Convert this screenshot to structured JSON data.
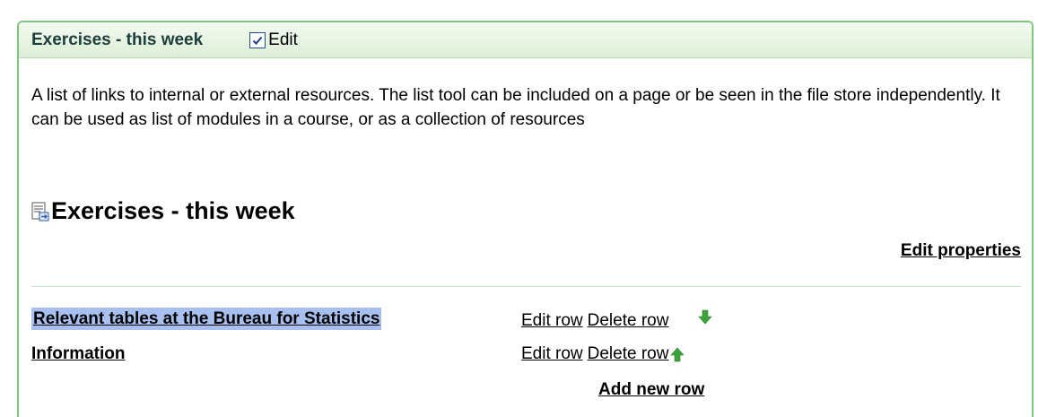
{
  "panel": {
    "title": "Exercises - this week",
    "edit_label": "Edit",
    "edit_checked": true
  },
  "description": "A list of links to internal or external resources. The list tool can be included on a page or be seen in the file store independently. It can be used as list of modules in a course, or as a collection of resources",
  "list": {
    "heading": "Exercises - this week",
    "edit_properties": "Edit properties",
    "rows": [
      {
        "title": "Relevant tables at the Bureau for Statistics",
        "edit": "Edit row",
        "delete": "Delete row",
        "arrow": "arrow-down"
      },
      {
        "title": "Information",
        "edit": "Edit row",
        "delete": "Delete row",
        "arrow": "arrow-up"
      }
    ],
    "add_new_row": "Add new row"
  },
  "colors": {
    "panel_border": "#7fc77f",
    "title_text": "#1e3d3d",
    "highlight": "#a8c0f0",
    "arrow_green": "#3aa43a"
  }
}
